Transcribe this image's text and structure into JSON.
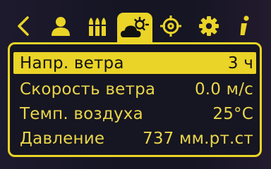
{
  "toolbar": {
    "tabs": [
      {
        "icon": "back-chevron-icon"
      },
      {
        "icon": "user-profile-icon"
      },
      {
        "icon": "ammo-cartridges-icon"
      },
      {
        "icon": "weather-cloud-sun-icon",
        "active": true
      },
      {
        "icon": "crosshair-target-icon"
      },
      {
        "icon": "gear-icon"
      },
      {
        "icon": "info-icon"
      }
    ]
  },
  "rows": [
    {
      "label": "Напр. ветра",
      "value": "3 ч",
      "selected": true
    },
    {
      "label": "Скорость ветра",
      "value": "0.0 м/с"
    },
    {
      "label": "Темп. воздуха",
      "value": "25°C"
    },
    {
      "label": "Давление",
      "value": "737 мм.рт.ст"
    }
  ],
  "colors": {
    "accent": "#ead427",
    "text": "#e8d64a",
    "background": "#161522"
  }
}
